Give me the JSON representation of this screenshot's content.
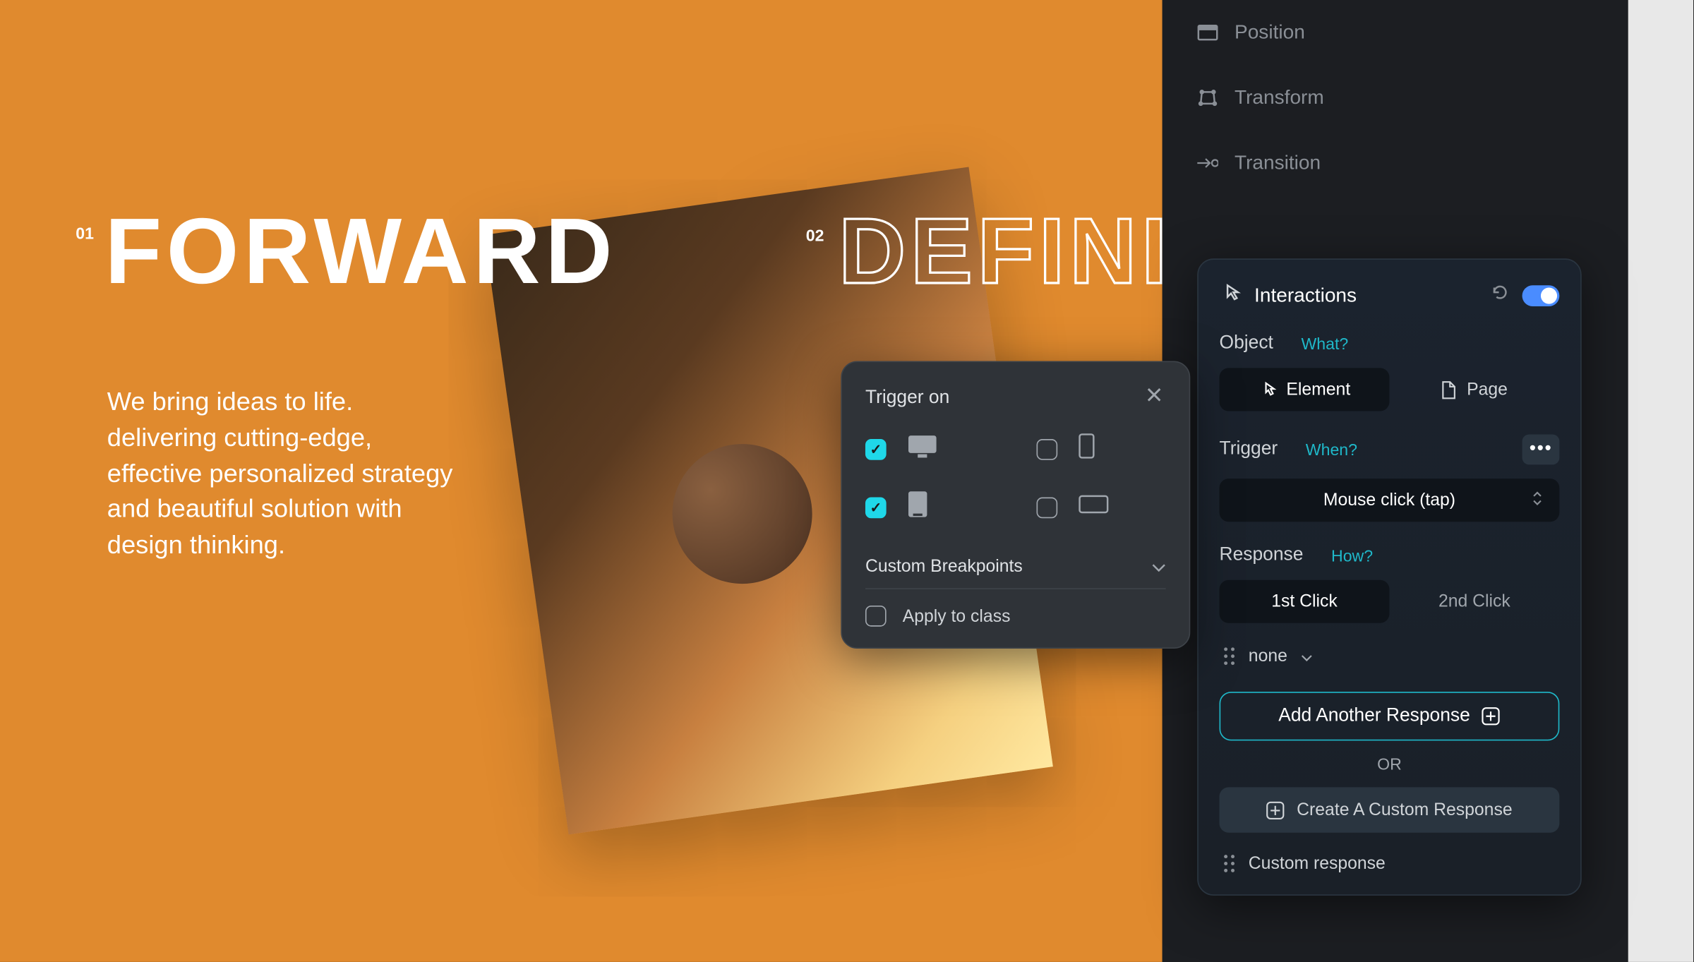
{
  "canvas": {
    "num1": "01",
    "heading1": "FORWARD",
    "num2": "02",
    "heading2": "DEFINI",
    "body": "We bring ideas to life. delivering cutting-edge, effective personalized strategy and beautiful solution with design thinking.",
    "background": "#e08a2e"
  },
  "right_panel": {
    "props": [
      "Position",
      "Transform",
      "Transition"
    ]
  },
  "interactions": {
    "title": "Interactions",
    "toggle_on": true,
    "object": {
      "label": "Object",
      "hint": "What?",
      "tabs": [
        "Element",
        "Page"
      ],
      "active": 0
    },
    "trigger": {
      "label": "Trigger",
      "hint": "When?",
      "value": "Mouse click (tap)"
    },
    "response": {
      "label": "Response",
      "hint": "How?",
      "tabs": [
        "1st Click",
        "2nd Click"
      ],
      "active": 0,
      "value": "none"
    },
    "add_response": "Add Another Response",
    "or": "OR",
    "create_custom": "Create A Custom Response",
    "custom_response": "Custom response"
  },
  "trigger_popup": {
    "title": "Trigger on",
    "devices": [
      {
        "name": "desktop",
        "on": true
      },
      {
        "name": "mobile-portrait",
        "on": false
      },
      {
        "name": "tablet",
        "on": true
      },
      {
        "name": "mobile-landscape",
        "on": false
      }
    ],
    "custom_breakpoints": "Custom Breakpoints",
    "apply_to_class": "Apply to class"
  }
}
